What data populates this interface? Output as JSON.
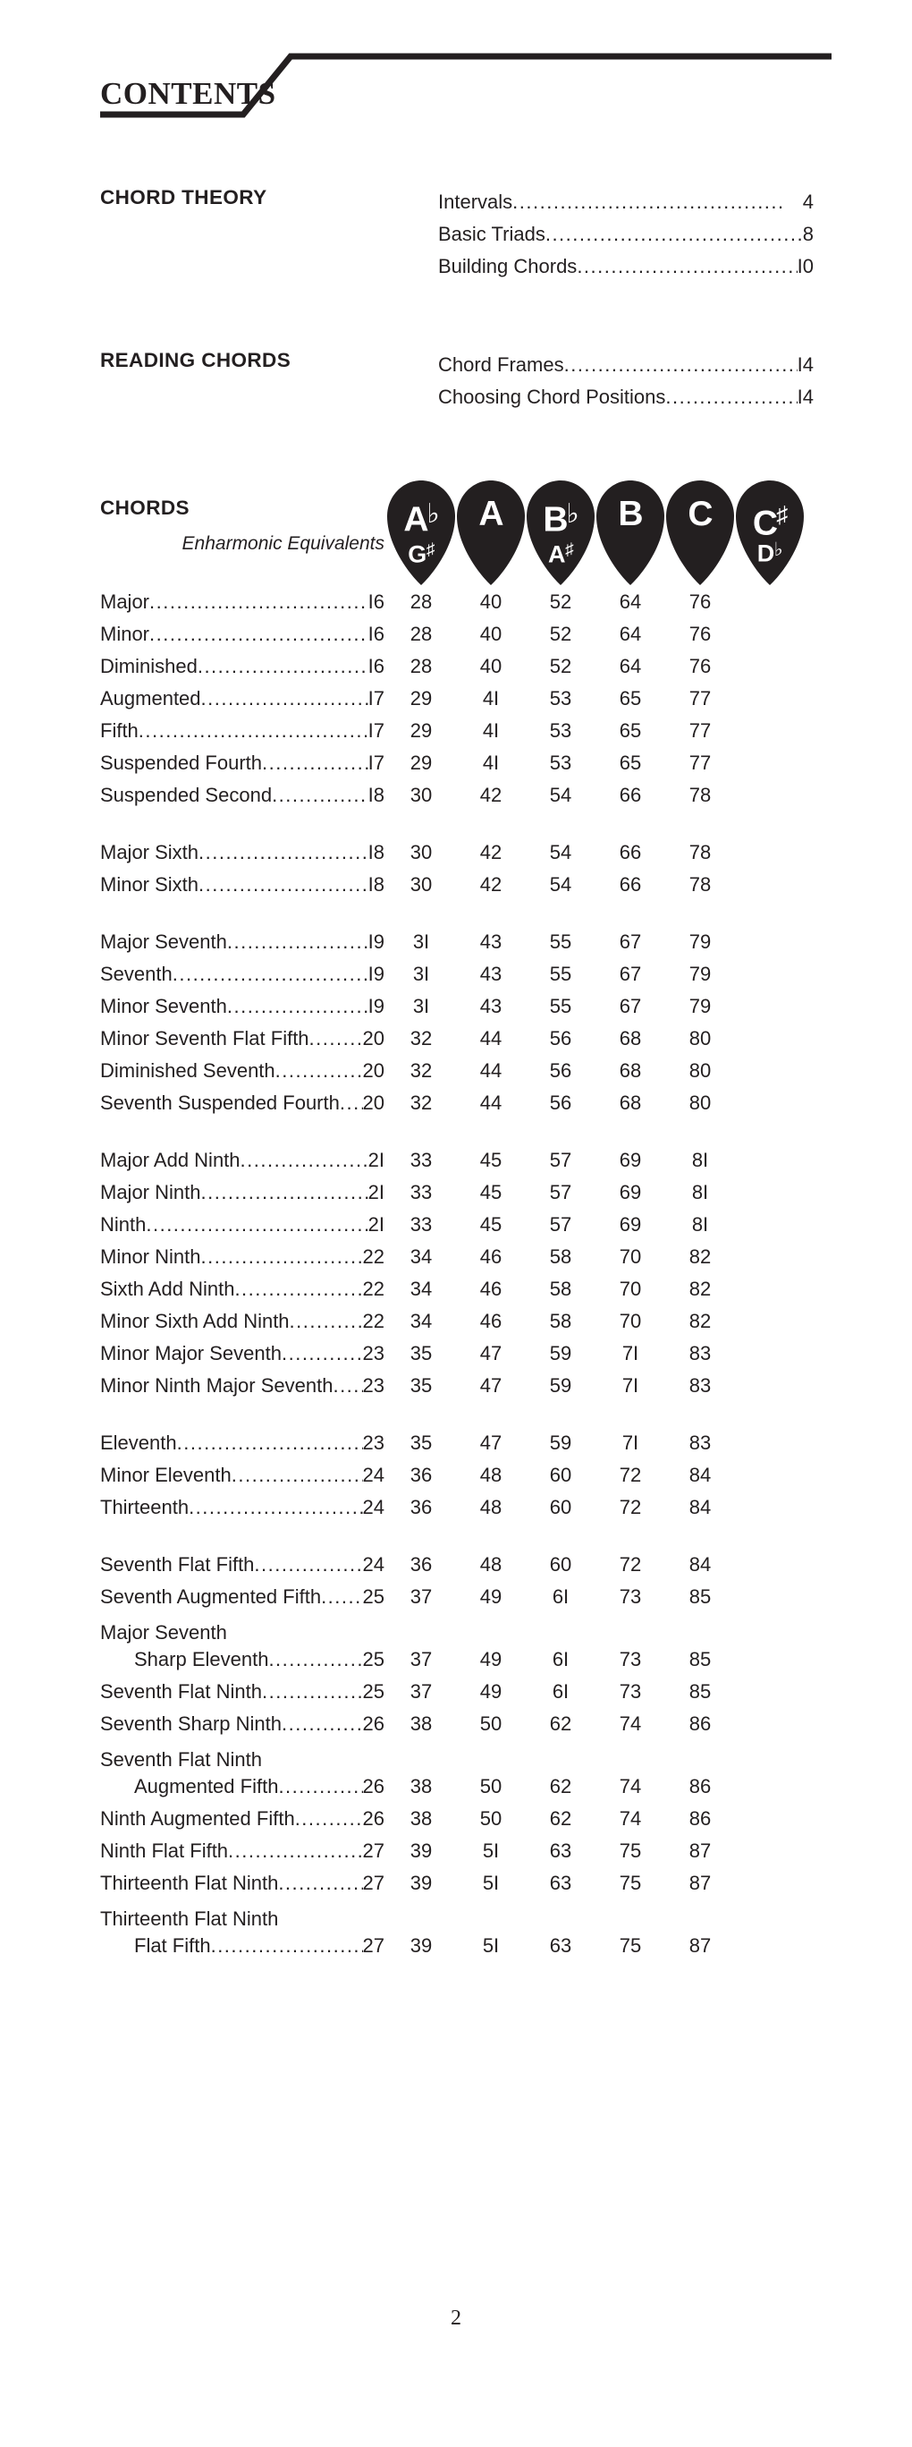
{
  "document": {
    "title": "CONTENTS",
    "page_number": "2"
  },
  "sections": [
    {
      "heading": "CHORD THEORY",
      "entries": [
        {
          "label": "Intervals ",
          "page": "4"
        },
        {
          "label": "Basic Triads ",
          "page": "8"
        },
        {
          "label": "Building Chords",
          "page": "I0"
        }
      ]
    },
    {
      "heading": "READING CHORDS",
      "entries": [
        {
          "label": "Chord Frames",
          "page": "I4"
        },
        {
          "label": "Choosing Chord Positions",
          "page": "I4"
        }
      ]
    }
  ],
  "chords": {
    "heading": "CHORDS",
    "enharmonic_label": "Enharmonic Equivalents",
    "columns": [
      {
        "root": "A",
        "root_accidental": "♭",
        "alt": "G",
        "alt_accidental": "♯"
      },
      {
        "root": "A",
        "root_accidental": "",
        "alt": "",
        "alt_accidental": ""
      },
      {
        "root": "B",
        "root_accidental": "♭",
        "alt": "A",
        "alt_accidental": "♯"
      },
      {
        "root": "B",
        "root_accidental": "",
        "alt": "",
        "alt_accidental": ""
      },
      {
        "root": "C",
        "root_accidental": "",
        "alt": "",
        "alt_accidental": ""
      },
      {
        "root": "C",
        "root_accidental": "♯",
        "alt": "D",
        "alt_accidental": "♭"
      }
    ],
    "groups": [
      {
        "rows": [
          {
            "name": "Major",
            "name2": "",
            "pages": [
              "I6",
              "28",
              "40",
              "52",
              "64",
              "76"
            ]
          },
          {
            "name": "Minor ",
            "name2": "",
            "pages": [
              "I6",
              "28",
              "40",
              "52",
              "64",
              "76"
            ]
          },
          {
            "name": "Diminished",
            "name2": "",
            "pages": [
              "I6",
              "28",
              "40",
              "52",
              "64",
              "76"
            ]
          },
          {
            "name": "Augmented ",
            "name2": "",
            "pages": [
              "I7",
              "29",
              "4I",
              "53",
              "65",
              "77"
            ]
          },
          {
            "name": "Fifth ",
            "name2": "",
            "pages": [
              "I7",
              "29",
              "4I",
              "53",
              "65",
              "77"
            ]
          },
          {
            "name": "Suspended Fourth",
            "name2": "",
            "pages": [
              "I7",
              "29",
              "4I",
              "53",
              "65",
              "77"
            ]
          },
          {
            "name": "Suspended Second ",
            "name2": "",
            "pages": [
              "I8",
              "30",
              "42",
              "54",
              "66",
              "78"
            ]
          }
        ]
      },
      {
        "rows": [
          {
            "name": "Major Sixth ",
            "name2": "",
            "pages": [
              "I8",
              "30",
              "42",
              "54",
              "66",
              "78"
            ]
          },
          {
            "name": "Minor Sixth",
            "name2": "",
            "pages": [
              "I8",
              "30",
              "42",
              "54",
              "66",
              "78"
            ]
          }
        ]
      },
      {
        "rows": [
          {
            "name": "Major Seventh ",
            "name2": "",
            "pages": [
              "I9",
              "3I",
              "43",
              "55",
              "67",
              "79"
            ]
          },
          {
            "name": "Seventh ",
            "name2": "",
            "pages": [
              "I9",
              "3I",
              "43",
              "55",
              "67",
              "79"
            ]
          },
          {
            "name": "Minor Seventh",
            "name2": "",
            "pages": [
              "I9",
              "3I",
              "43",
              "55",
              "67",
              "79"
            ]
          },
          {
            "name": "Minor Seventh Flat Fifth",
            "name2": "",
            "pages": [
              "20",
              "32",
              "44",
              "56",
              "68",
              "80"
            ]
          },
          {
            "name": "Diminished Seventh ",
            "name2": "",
            "pages": [
              "20",
              "32",
              "44",
              "56",
              "68",
              "80"
            ]
          },
          {
            "name": "Seventh Suspended Fourth ",
            "name2": "",
            "pages": [
              "20",
              "32",
              "44",
              "56",
              "68",
              "80"
            ]
          }
        ]
      },
      {
        "rows": [
          {
            "name": "Major Add Ninth ",
            "name2": "",
            "pages": [
              "2I",
              "33",
              "45",
              "57",
              "69",
              "8I"
            ]
          },
          {
            "name": "Major Ninth",
            "name2": "",
            "pages": [
              "2I",
              "33",
              "45",
              "57",
              "69",
              "8I"
            ]
          },
          {
            "name": "Ninth",
            "name2": "",
            "pages": [
              "2I",
              "33",
              "45",
              "57",
              "69",
              "8I"
            ]
          },
          {
            "name": "Minor Ninth ",
            "name2": "",
            "pages": [
              "22",
              "34",
              "46",
              "58",
              "70",
              "82"
            ]
          },
          {
            "name": "Sixth Add Ninth",
            "name2": "",
            "pages": [
              "22",
              "34",
              "46",
              "58",
              "70",
              "82"
            ]
          },
          {
            "name": "Minor Sixth Add Ninth",
            "name2": "",
            "pages": [
              "22",
              "34",
              "46",
              "58",
              "70",
              "82"
            ]
          },
          {
            "name": "Minor Major Seventh",
            "name2": "",
            "pages": [
              "23",
              "35",
              "47",
              "59",
              "7I",
              "83"
            ]
          },
          {
            "name": "Minor Ninth Major Seventh",
            "name2": "",
            "pages": [
              "23",
              "35",
              "47",
              "59",
              "7I",
              "83"
            ]
          }
        ]
      },
      {
        "rows": [
          {
            "name": "Eleventh",
            "name2": "",
            "pages": [
              "23",
              "35",
              "47",
              "59",
              "7I",
              "83"
            ]
          },
          {
            "name": "Minor Eleventh",
            "name2": "",
            "pages": [
              "24",
              "36",
              "48",
              "60",
              "72",
              "84"
            ]
          },
          {
            "name": "Thirteenth",
            "name2": "",
            "pages": [
              "24",
              "36",
              "48",
              "60",
              "72",
              "84"
            ]
          }
        ]
      },
      {
        "rows": [
          {
            "name": "Seventh Flat Fifth",
            "name2": "",
            "pages": [
              "24",
              "36",
              "48",
              "60",
              "72",
              "84"
            ]
          },
          {
            "name": "Seventh Augmented Fifth",
            "name2": "",
            "pages": [
              "25",
              "37",
              "49",
              "6I",
              "73",
              "85"
            ]
          },
          {
            "name": "Major Seventh",
            "name2": "Sharp Eleventh",
            "pages": [
              "25",
              "37",
              "49",
              "6I",
              "73",
              "85"
            ]
          },
          {
            "name": "Seventh Flat Ninth ",
            "name2": "",
            "pages": [
              "25",
              "37",
              "49",
              "6I",
              "73",
              "85"
            ]
          },
          {
            "name": "Seventh Sharp Ninth",
            "name2": "",
            "pages": [
              "26",
              "38",
              "50",
              "62",
              "74",
              "86"
            ]
          },
          {
            "name": "Seventh Flat Ninth",
            "name2": "Augmented Fifth ",
            "pages": [
              "26",
              "38",
              "50",
              "62",
              "74",
              "86"
            ]
          },
          {
            "name": "Ninth Augmented Fifth ",
            "name2": "",
            "pages": [
              "26",
              "38",
              "50",
              "62",
              "74",
              "86"
            ]
          },
          {
            "name": "Ninth Flat Fifth",
            "name2": "",
            "pages": [
              "27",
              "39",
              "5I",
              "63",
              "75",
              "87"
            ]
          },
          {
            "name": "Thirteenth Flat Ninth",
            "name2": "",
            "pages": [
              "27",
              "39",
              "5I",
              "63",
              "75",
              "87"
            ]
          },
          {
            "name": "Thirteenth Flat Ninth",
            "name2": "Flat Fifth ",
            "pages": [
              "27",
              "39",
              "5I",
              "63",
              "75",
              "87"
            ]
          }
        ]
      }
    ]
  },
  "colors": {
    "ink": "#231f20",
    "paper": "#ffffff"
  }
}
